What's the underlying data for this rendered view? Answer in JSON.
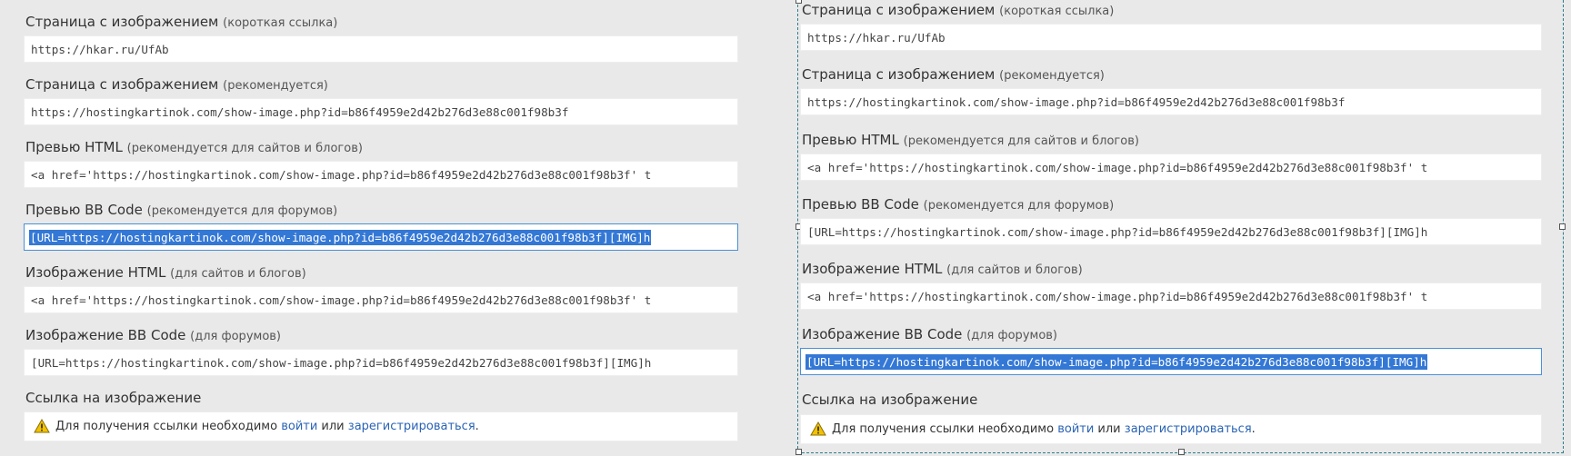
{
  "panels": {
    "left": {
      "fields": [
        {
          "label": "Страница с изображением",
          "hint": "(короткая ссылка)",
          "value": "https://hkar.ru/UfAb"
        },
        {
          "label": "Страница с изображением",
          "hint": "(рекомендуется)",
          "value": "https://hostingkartinok.com/show-image.php?id=b86f4959e2d42b276d3e88c001f98b3f"
        },
        {
          "label": "Превью HTML",
          "hint": "(рекомендуется для сайтов и блогов)",
          "value": "<a href='https://hostingkartinok.com/show-image.php?id=b86f4959e2d42b276d3e88c001f98b3f' t"
        },
        {
          "label": "Превью BB Code",
          "hint": "(рекомендуется для форумов)",
          "value": "[URL=https://hostingkartinok.com/show-image.php?id=b86f4959e2d42b276d3e88c001f98b3f][IMG]h"
        },
        {
          "label": "Изображение HTML",
          "hint": "(для сайтов и блогов)",
          "value": "<a href='https://hostingkartinok.com/show-image.php?id=b86f4959e2d42b276d3e88c001f98b3f' t"
        },
        {
          "label": "Изображение BB Code",
          "hint": "(для форумов)",
          "value": "[URL=https://hostingkartinok.com/show-image.php?id=b86f4959e2d42b276d3e88c001f98b3f][IMG]h"
        }
      ],
      "link_label": "Ссылка на изображение",
      "notice": {
        "text_before": "Для получения ссылки необходимо ",
        "login": "войти",
        "middle": " или ",
        "register": "зарегистрироваться",
        "after": "."
      }
    },
    "right": {
      "fields": [
        {
          "label": "Страница с изображением",
          "hint": "(короткая ссылка)",
          "value": "https://hkar.ru/UfAb"
        },
        {
          "label": "Страница с изображением",
          "hint": "(рекомендуется)",
          "value": "https://hostingkartinok.com/show-image.php?id=b86f4959e2d42b276d3e88c001f98b3f"
        },
        {
          "label": "Превью HTML",
          "hint": "(рекомендуется для сайтов и блогов)",
          "value": "<a href='https://hostingkartinok.com/show-image.php?id=b86f4959e2d42b276d3e88c001f98b3f' t"
        },
        {
          "label": "Превью BB Code",
          "hint": "(рекомендуется для форумов)",
          "value": "[URL=https://hostingkartinok.com/show-image.php?id=b86f4959e2d42b276d3e88c001f98b3f][IMG]h"
        },
        {
          "label": "Изображение HTML",
          "hint": "(для сайтов и блогов)",
          "value": "<a href='https://hostingkartinok.com/show-image.php?id=b86f4959e2d42b276d3e88c001f98b3f' t"
        },
        {
          "label": "Изображение BB Code",
          "hint": "(для форумов)",
          "value": "[URL=https://hostingkartinok.com/show-image.php?id=b86f4959e2d42b276d3e88c001f98b3f][IMG]h"
        }
      ],
      "link_label": "Ссылка на изображение",
      "notice": {
        "text_before": "Для получения ссылки необходимо ",
        "login": "войти",
        "middle": " или ",
        "register": "зарегистрироваться",
        "after": "."
      }
    }
  },
  "colors": {
    "selection": "#3478d6",
    "link": "#2a63b5",
    "frame": "#2a7f8e",
    "warning": "#f2c200"
  },
  "icons": {
    "notice": "warning-icon"
  }
}
